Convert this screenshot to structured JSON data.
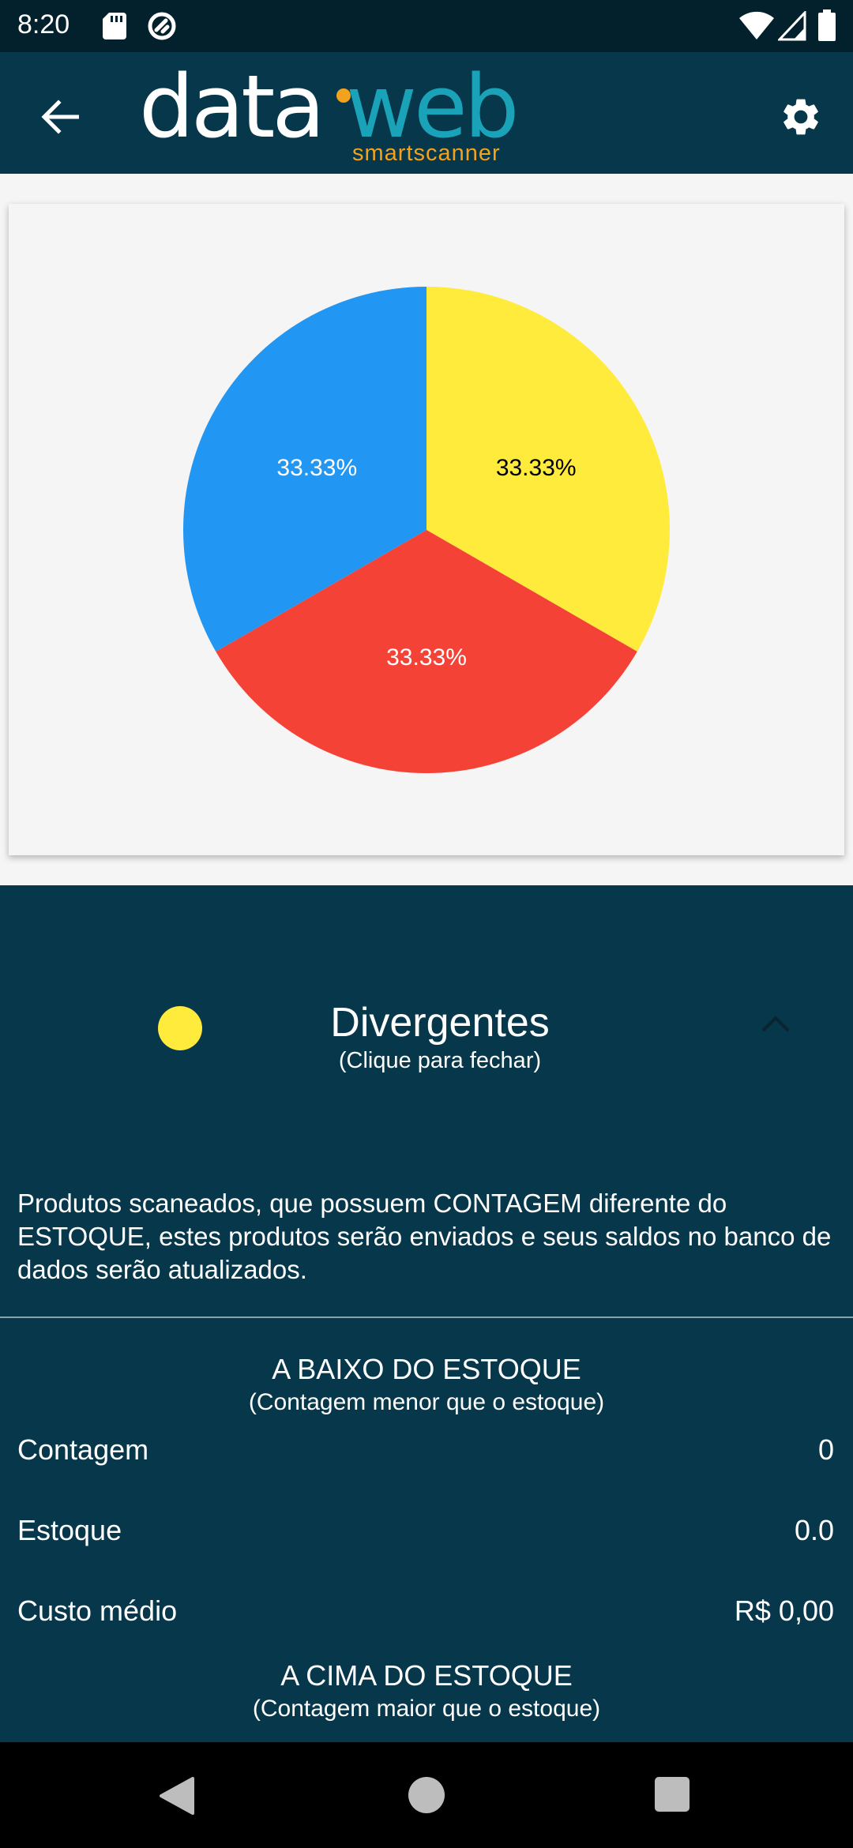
{
  "status_bar": {
    "time": "8:20",
    "icons": [
      "sd-card-icon",
      "do-not-disturb-icon",
      "wifi-icon",
      "signal-icon",
      "battery-icon"
    ]
  },
  "app_bar": {
    "logo_part1": "data",
    "logo_part2": "web",
    "logo_subtitle": "smartscanner",
    "back_icon": "arrow-back-icon",
    "settings_icon": "gear-icon"
  },
  "chart_data": {
    "type": "pie",
    "slices": [
      {
        "label": "33.33%",
        "value": 33.33,
        "color": "#ffeb3b",
        "label_color": "#000000"
      },
      {
        "label": "33.33%",
        "value": 33.33,
        "color": "#f44336",
        "label_color": "#ffffff"
      },
      {
        "label": "33.33%",
        "value": 33.33,
        "color": "#2196f3",
        "label_color": "#ffffff"
      }
    ]
  },
  "legend": {
    "color": "#ffeb3b",
    "title": "Divergentes",
    "subtitle": "(Clique para fechar)",
    "description": "Produtos scaneados, que possuem CONTAGEM diferente do ESTOQUE, estes produtos serão enviados e seus saldos no banco de dados serão atualizados."
  },
  "below_stock": {
    "title": "A BAIXO DO ESTOQUE",
    "subtitle": "(Contagem menor que o estoque)",
    "rows": [
      {
        "label": "Contagem",
        "value": "0"
      },
      {
        "label": "Estoque",
        "value": "0.0"
      },
      {
        "label": "Custo médio",
        "value": "R$ 0,00"
      }
    ]
  },
  "above_stock": {
    "title": "A CIMA DO ESTOQUE",
    "subtitle": "(Contagem maior que o estoque)"
  },
  "colors": {
    "app_bar": "#06374a",
    "status_bar": "#02212d",
    "accent_orange": "#f3a21d",
    "accent_teal": "#1aa3b8"
  }
}
